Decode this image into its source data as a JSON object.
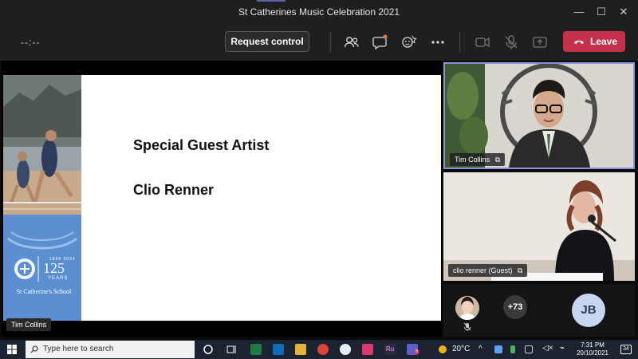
{
  "window": {
    "title": "St Catherines Music Celebration 2021",
    "minimize": "—",
    "maximize": "☐",
    "close": "✕"
  },
  "toolbar": {
    "timer": "--:--",
    "request_control_label": "Request control",
    "leave_label": "Leave",
    "leave_color": "#c4314b"
  },
  "slide": {
    "title": "Special Guest Artist",
    "artist": "Clio Renner",
    "school_name": "St Catherine's School",
    "anniversary_number": "125",
    "anniversary_word": "YEARS",
    "anniversary_range": "1896 2021"
  },
  "presenter": {
    "name": "Tim Collins"
  },
  "tiles": [
    {
      "name": "Tim Collins"
    },
    {
      "name": "clio renner (Guest)"
    }
  ],
  "participants": {
    "overflow_count": "+73",
    "initials": "JB"
  },
  "taskbar": {
    "search_placeholder": "Type here to search",
    "temperature": "20°C",
    "time": "7:31 PM",
    "date": "20/10/2021",
    "notification_count": "34",
    "teams_badge": "6"
  }
}
